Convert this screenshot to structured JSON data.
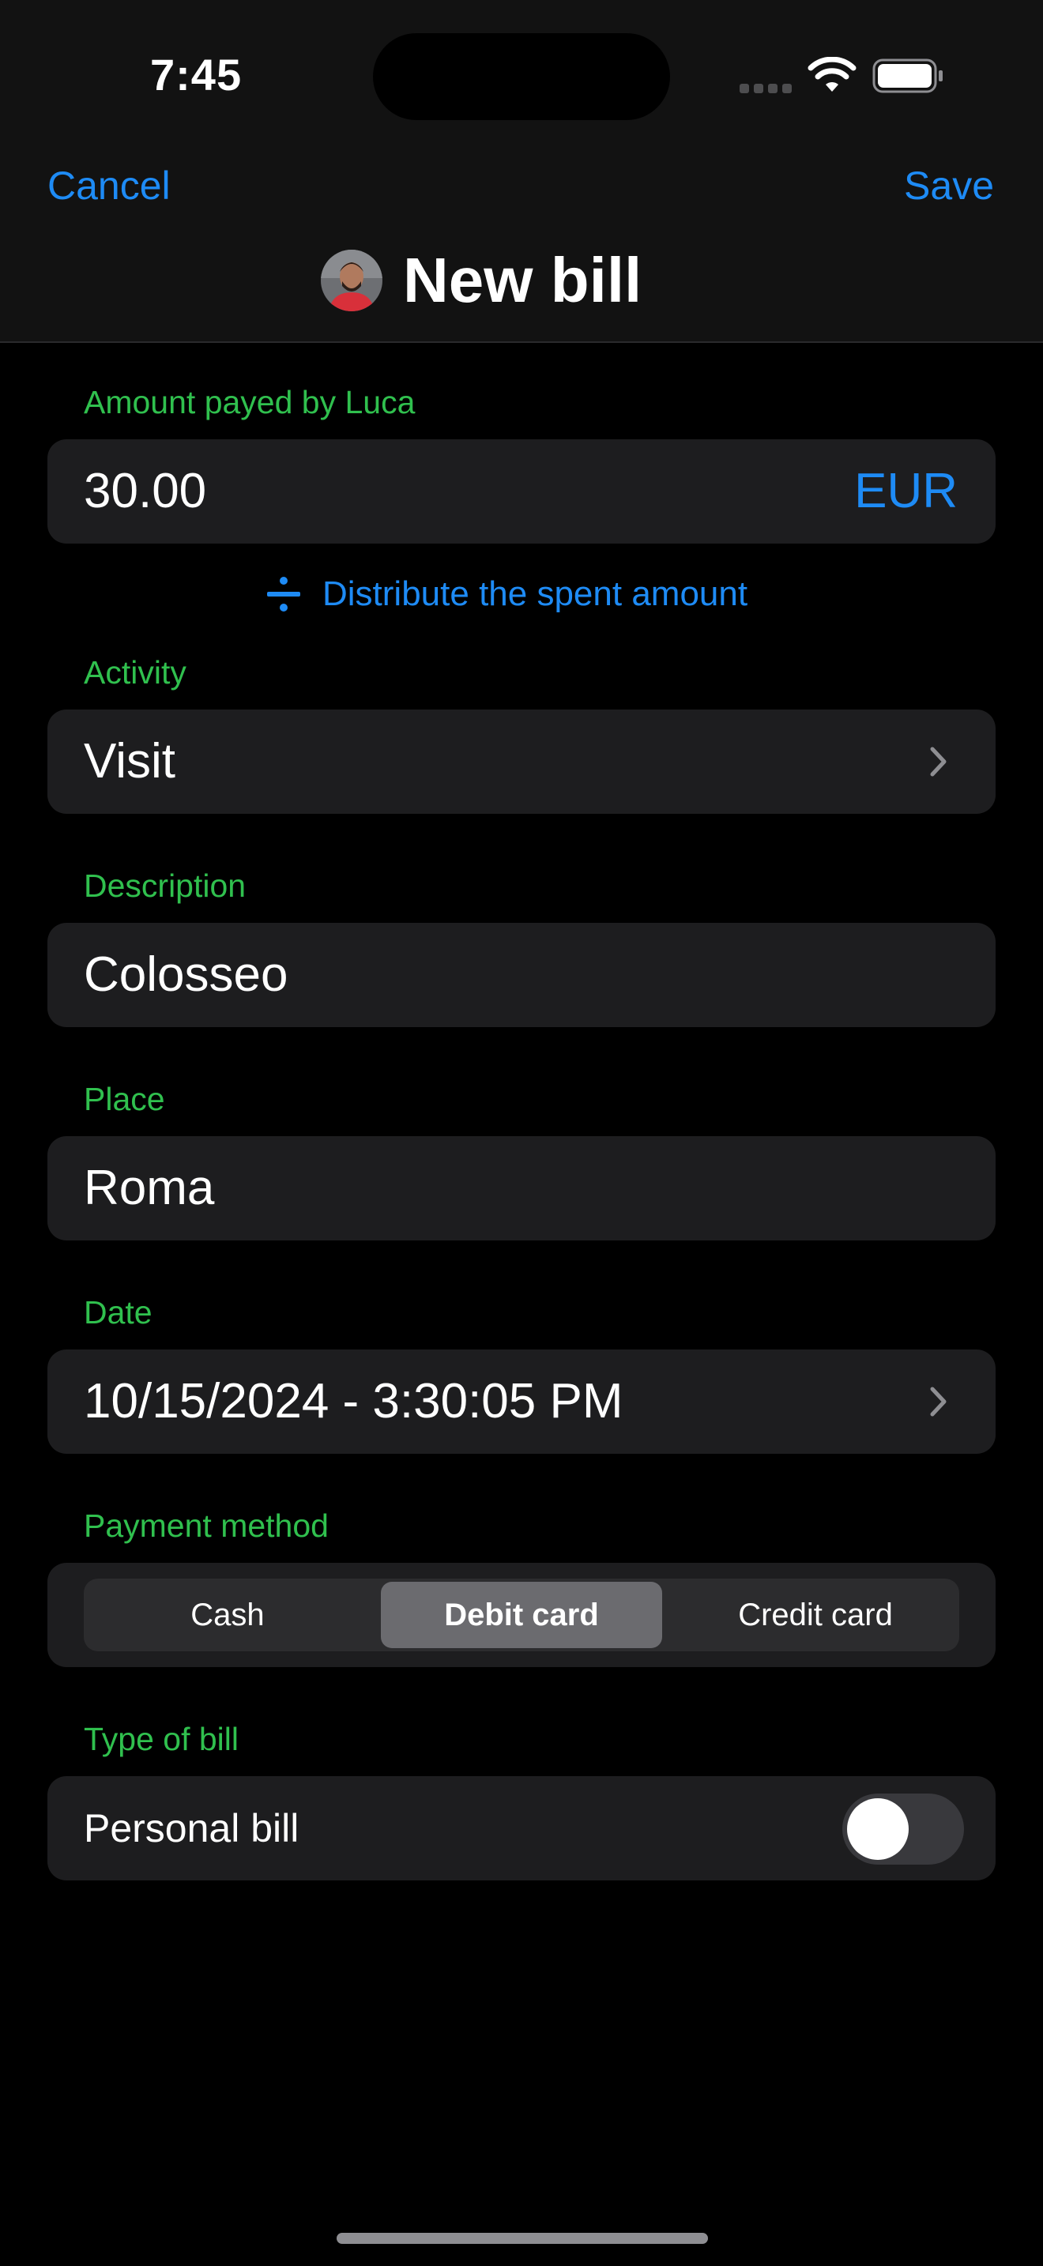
{
  "status_bar": {
    "time": "7:45"
  },
  "nav": {
    "cancel_label": "Cancel",
    "save_label": "Save",
    "title": "New bill"
  },
  "form": {
    "amount": {
      "label": "Amount payed by Luca",
      "value": "30.00",
      "currency": "EUR"
    },
    "distribute_label": "Distribute the spent amount",
    "activity": {
      "label": "Activity",
      "value": "Visit"
    },
    "description": {
      "label": "Description",
      "value": "Colosseo"
    },
    "place": {
      "label": "Place",
      "value": "Roma"
    },
    "date": {
      "label": "Date",
      "value": "10/15/2024 - 3:30:05 PM"
    },
    "payment_method": {
      "label": "Payment method",
      "options": [
        "Cash",
        "Debit card",
        "Credit card"
      ],
      "selected": "Debit card"
    },
    "type_of_bill": {
      "label": "Type of bill",
      "toggle_label": "Personal bill",
      "toggle_on": false
    }
  },
  "colors": {
    "accent": "#1e8bf5",
    "section_label": "#30c04e",
    "field_background": "#1d1d1f",
    "page_background": "#000000"
  },
  "icons": [
    "wifi-icon",
    "battery-icon",
    "signal-icon",
    "avatar",
    "divide-icon",
    "chevron-right-icon"
  ]
}
